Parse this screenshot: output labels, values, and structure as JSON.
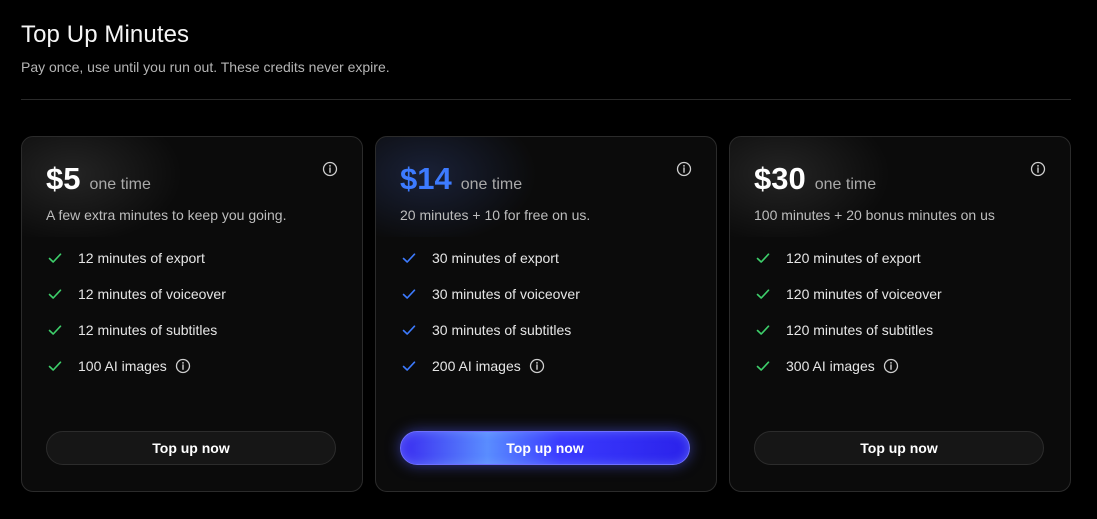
{
  "header": {
    "title": "Top Up Minutes",
    "subtitle": "Pay once, use until you run out. These credits never expire."
  },
  "colors": {
    "accent_blue": "#3d7bff",
    "check_green": "#3ecf6b",
    "check_blue": "#3d7bff",
    "button_gradient_start": "#3a2cf0",
    "button_gradient_end": "#2b22ea"
  },
  "plans": [
    {
      "price": "$5",
      "price_note": "one time",
      "description": "A few extra minutes to keep you going.",
      "features": [
        "12 minutes of export",
        "12 minutes of voiceover",
        "12 minutes of subtitles",
        "100 AI images"
      ],
      "button_label": "Top up now",
      "check_icon": "check-icon",
      "check_color": "green"
    },
    {
      "price": "$14",
      "price_note": "one time",
      "description": "20 minutes + 10 for free on us.",
      "features": [
        "30 minutes of export",
        "30 minutes of voiceover",
        "30 minutes of subtitles",
        "200 AI images"
      ],
      "button_label": "Top up now",
      "check_icon": "check-icon",
      "check_color": "blue",
      "featured": true
    },
    {
      "price": "$30",
      "price_note": "one time",
      "description": "100 minutes + 20 bonus minutes on us",
      "features": [
        "120 minutes of export",
        "120 minutes of voiceover",
        "120 minutes of subtitles",
        "300 AI images"
      ],
      "button_label": "Top up now",
      "check_icon": "check-icon",
      "check_color": "green"
    }
  ]
}
